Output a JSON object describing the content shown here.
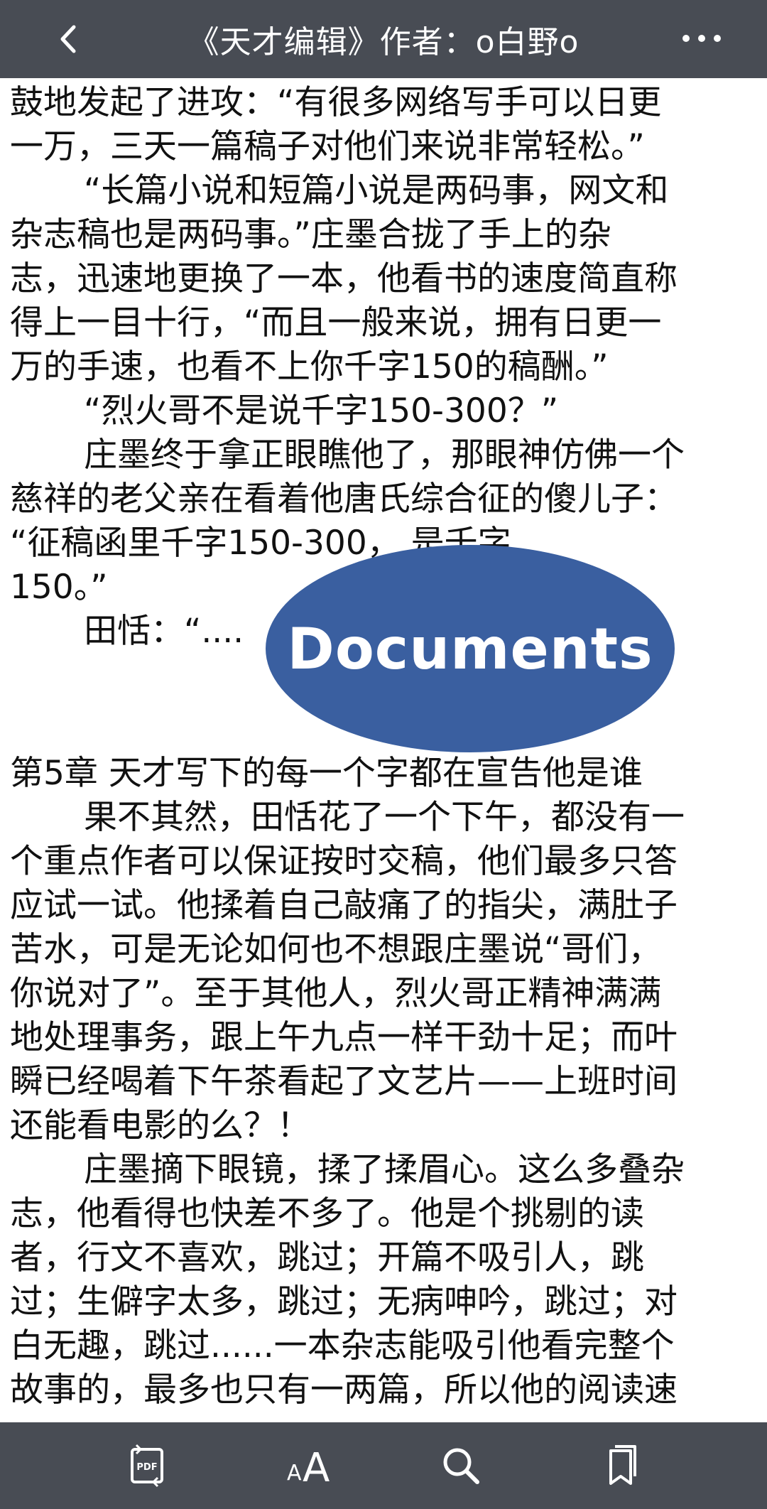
{
  "header": {
    "title": "《天才编辑》作者：o白野o",
    "back_icon": "chevron-left-icon",
    "more_icon": "more-dots-icon"
  },
  "content": {
    "lines": [
      "鼓地发起了进攻：“有很多网络写手可以日更",
      "一万，三天一篇稿子对他们来说非常轻松。”",
      "“长篇小说和短篇小说是两码事，网文和",
      "杂志稿也是两码事。”庄墨合拢了手上的杂",
      "志，迅速地更换了一本，他看书的速度简直称",
      "得上一目十行，“而且一般来说，拥有日更一",
      "万的手速，也看不上你千字150的稿酬。”",
      "“烈火哥不是说千字150-300？”",
      "庄墨终于拿正眼瞧他了，那眼神仿佛一个",
      "慈祥的老父亲在看着他唐氏综合征的傻儿子：",
      "“征稿函里千字150-300，         是千字",
      "150。”",
      "田恬：“....",
      "",
      "第5章 天才写下的每一个字都在宣告他是谁",
      "果不其然，田恬花了一个下午，都没有一",
      "个重点作者可以保证按时交稿，他们最多只答",
      "应试一试。他揉着自己敲痛了的指尖，满肚子",
      "苦水，可是无论如何也不想跟庄墨说“哥们，",
      "你说对了”。至于其他人，烈火哥正精神满满",
      "地处理事务，跟上午九点一样干劲十足；而叶",
      "瞬已经喝着下午茶看起了文艺片——上班时间",
      "还能看电影的么？！",
      "庄墨摘下眼镜，揉了揉眉心。这么多叠杂",
      "志，他看得也快差不多了。他是个挑剔的读",
      "者，行文不喜欢，跳过；开篇不吸引人，跳",
      "过；生僻字太多，跳过；无病呻吟，跳过；对",
      "白无趣，跳过......一本杂志能吸引他看完整个",
      "故事的，最多也只有一两篇，所以他的阅读速"
    ]
  },
  "overlay": {
    "label": "Documents"
  },
  "toolbar": {
    "pdf_icon": "pdf-convert-icon",
    "font_label_small": "A",
    "font_label_large": "A",
    "search_icon": "search-icon",
    "bookmark_icon": "bookmarks-icon"
  },
  "colors": {
    "bar_bg": "#484c54",
    "overlay_bg": "#3a5fa0",
    "text": "#111111"
  }
}
